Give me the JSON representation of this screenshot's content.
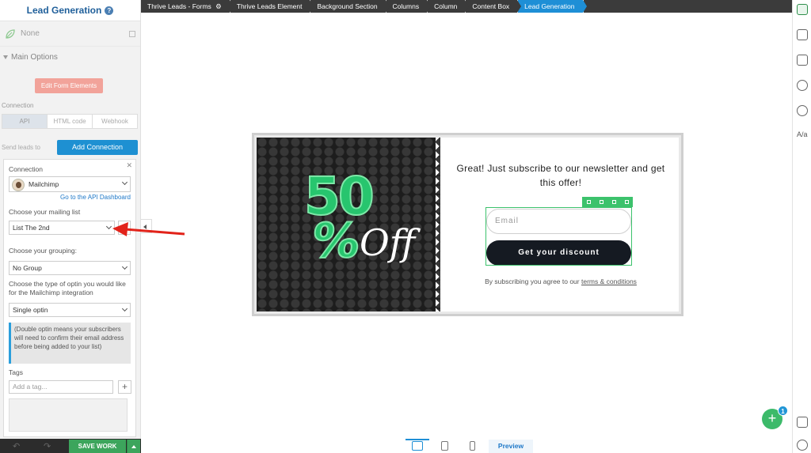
{
  "sidebar": {
    "title": "Lead Generation",
    "help_icon": "?",
    "none_label": "None",
    "main_options": "Main Options",
    "edit_form_elements": "Edit Form Elements",
    "connection_label": "Connection",
    "tabs": [
      "API",
      "HTML code",
      "Webhook"
    ],
    "send_leads_label": "Send leads to",
    "add_connection": "Add Connection",
    "panel": {
      "connection_title": "Connection",
      "service": "Mailchimp",
      "api_link": "Go to the API Dashboard",
      "mailing_list_label": "Choose your mailing list",
      "mailing_list_value": "List The 2nd",
      "grouping_label": "Choose your grouping:",
      "grouping_value": "No Group",
      "optin_label": "Choose the type of optin you would like for the Mailchimp integration",
      "optin_value": "Single optin",
      "optin_info": "(Double optin means your subscribers will need to confirm their email address before being added to your list)",
      "tags_label": "Tags",
      "tags_placeholder": "Add a tag...",
      "tags_add": "+"
    },
    "save_work": "SAVE WORK"
  },
  "breadcrumbs": [
    "Thrive Leads - Forms",
    "Thrive Leads Element",
    "Background Section",
    "Columns",
    "Column",
    "Content Box",
    "Lead Generation"
  ],
  "form": {
    "promo_number": "50",
    "promo_percent": "%",
    "promo_off": "Off",
    "headline": "Great! Just subscribe to our newsletter and get this offer!",
    "email_placeholder": "Email",
    "button": "Get your discount",
    "terms_prefix": "By subscribing you agree to our",
    "terms_link": "terms & conditions"
  },
  "bottom": {
    "preview": "Preview"
  },
  "fab": {
    "plus": "+",
    "badge": "1"
  },
  "colors": {
    "accent_green": "#3cba6a",
    "accent_blue": "#1e8fd6",
    "promo_green": "#27c56e",
    "arrow_red": "#e2231a"
  }
}
